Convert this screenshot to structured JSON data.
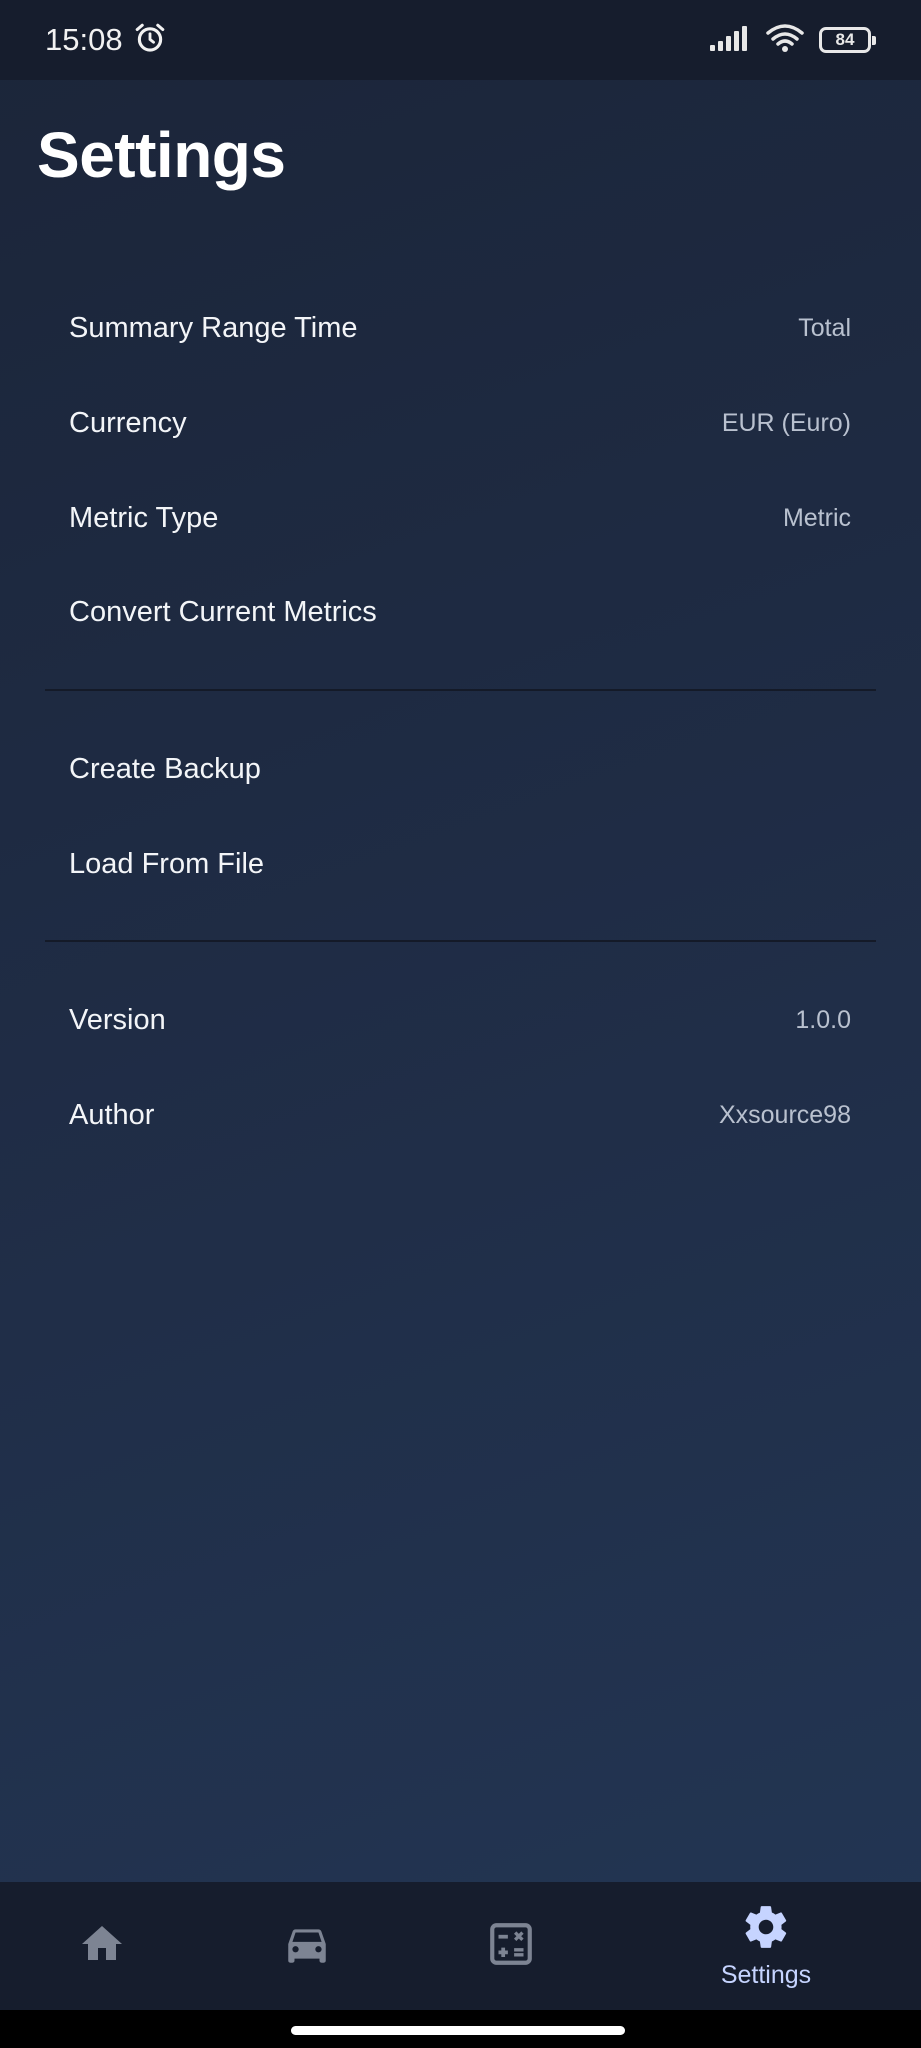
{
  "status_bar": {
    "time": "15:08",
    "battery": "84",
    "icons": [
      "alarm-icon",
      "signal-icon",
      "wifi-icon",
      "battery-icon"
    ]
  },
  "page": {
    "title": "Settings"
  },
  "settings": {
    "summary_range_time": {
      "label": "Summary Range Time",
      "value": "Total"
    },
    "currency": {
      "label": "Currency",
      "value": "EUR (Euro)"
    },
    "metric_type": {
      "label": "Metric Type",
      "value": "Metric"
    },
    "convert_current_metrics": {
      "label": "Convert Current Metrics"
    },
    "create_backup": {
      "label": "Create Backup"
    },
    "load_from_file": {
      "label": "Load From File"
    },
    "version": {
      "label": "Version",
      "value": "1.0.0"
    },
    "author": {
      "label": "Author",
      "value": "Xxsource98"
    }
  },
  "bottom_nav": {
    "items": [
      {
        "icon": "home-icon",
        "label": ""
      },
      {
        "icon": "car-icon",
        "label": ""
      },
      {
        "icon": "calculator-icon",
        "label": ""
      },
      {
        "icon": "gear-icon",
        "label": "Settings",
        "active": true
      }
    ]
  },
  "colors": {
    "background_top": "#1b2539",
    "background_bottom": "#233654",
    "bar": "#161d2d",
    "active_accent": "#c6d4ff",
    "inactive_icon": "#7d8493"
  }
}
